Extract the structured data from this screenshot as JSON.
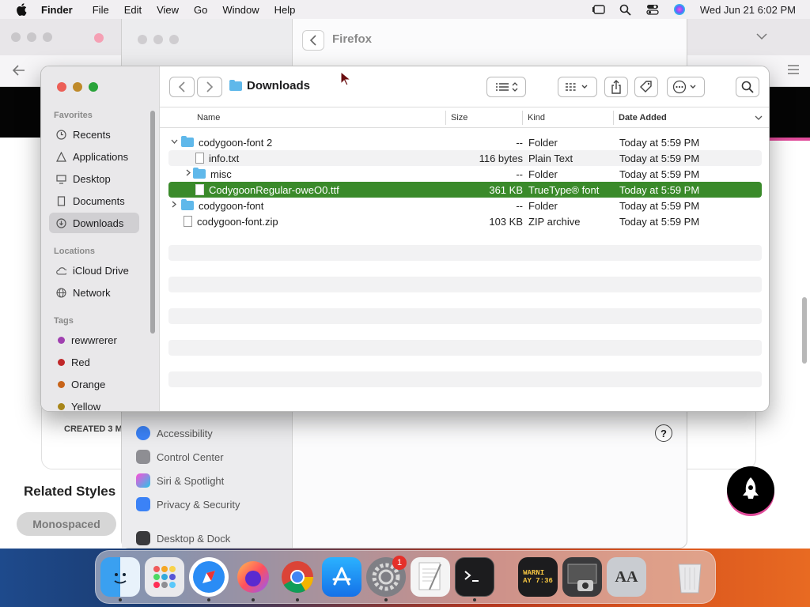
{
  "menubar": {
    "app_name": "Finder",
    "items": [
      "File",
      "Edit",
      "View",
      "Go",
      "Window",
      "Help"
    ],
    "clock": "Wed Jun 21  6:02 PM"
  },
  "browser": {
    "related_heading": "Related Styles",
    "tag_button": "Monospaced",
    "created_text": "CREATED 3 M"
  },
  "settings": {
    "title": "Firefox",
    "sidebar_items": [
      "Accessibility",
      "Control Center",
      "Siri & Spotlight",
      "Privacy & Security",
      "Desktop & Dock"
    ]
  },
  "finder": {
    "title": "Downloads",
    "sections": {
      "favorites": "Favorites",
      "locations": "Locations",
      "tags": "Tags"
    },
    "favorites": [
      {
        "label": "Recents",
        "icon": "clock-icon"
      },
      {
        "label": "Applications",
        "icon": "applications-icon"
      },
      {
        "label": "Desktop",
        "icon": "desktop-icon"
      },
      {
        "label": "Documents",
        "icon": "document-icon"
      },
      {
        "label": "Downloads",
        "icon": "download-icon",
        "selected": true
      }
    ],
    "locations": [
      {
        "label": "iCloud Drive",
        "icon": "cloud-icon"
      },
      {
        "label": "Network",
        "icon": "globe-icon"
      }
    ],
    "tags": [
      {
        "label": "rewwrerer",
        "color": "#a040b0"
      },
      {
        "label": "Red",
        "color": "#c0282a"
      },
      {
        "label": "Orange",
        "color": "#c8641a"
      },
      {
        "label": "Yellow",
        "color": "#a8861a"
      }
    ],
    "columns": {
      "name": "Name",
      "size": "Size",
      "kind": "Kind",
      "date": "Date Added"
    },
    "rows": [
      {
        "name": "codygoon-font 2",
        "size": "--",
        "kind": "Folder",
        "date": "Today at 5:59 PM",
        "type": "folder",
        "disclosure": "open"
      },
      {
        "name": "info.txt",
        "size": "116 bytes",
        "kind": "Plain Text",
        "date": "Today at 5:59 PM",
        "type": "file"
      },
      {
        "name": "misc",
        "size": "--",
        "kind": "Folder",
        "date": "Today at 5:59 PM",
        "type": "folder",
        "disclosure": "closed"
      },
      {
        "name": "CodygoonRegular-oweO0.ttf",
        "size": "361 KB",
        "kind": "TrueType® font",
        "date": "Today at 5:59 PM",
        "type": "file",
        "selected": true
      },
      {
        "name": "codygoon-font",
        "size": "--",
        "kind": "Folder",
        "date": "Today at 5:59 PM",
        "type": "folder",
        "disclosure": "closed"
      },
      {
        "name": "codygoon-font.zip",
        "size": "103 KB",
        "kind": "ZIP archive",
        "date": "Today at 5:59 PM",
        "type": "file"
      }
    ]
  },
  "dock": {
    "apps": [
      "finder-icon",
      "launchpad-icon",
      "safari-icon",
      "firefox-icon",
      "chrome-icon",
      "app-store-icon",
      "system-settings-icon",
      "textedit-icon",
      "terminal-icon",
      "console-icon",
      "screenshot-icon",
      "font-book-icon",
      "trash-icon"
    ],
    "console_label": "WARNI\nAY 7:36",
    "font_book_label": "AA",
    "settings_badge": "1"
  },
  "colors": {
    "selection": "#3a8a2a",
    "folder": "#5fb8ea",
    "close": "#ec5f57",
    "minimize": "#bf8a2a",
    "zoom": "#29a33a"
  }
}
